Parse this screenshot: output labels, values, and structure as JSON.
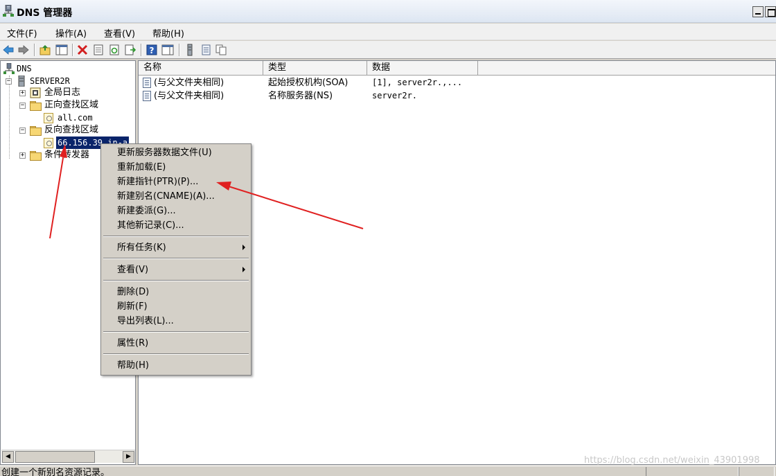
{
  "window": {
    "title": "DNS 管理器",
    "icon": "dns-server-icon"
  },
  "menubar": {
    "items": [
      "文件(F)",
      "操作(A)",
      "查看(V)",
      "帮助(H)"
    ]
  },
  "toolbar": {
    "icons": [
      "back-arrow-icon",
      "forward-arrow-icon",
      "up-folder-icon",
      "show-hide-tree-icon",
      "delete-icon",
      "properties-icon",
      "refresh-icon",
      "export-list-icon",
      "help-icon",
      "console-icon",
      "server-icon",
      "records-icon",
      "copy-icon"
    ]
  },
  "tree": {
    "root": "DNS",
    "server": "SERVER2R",
    "global_log": "全局日志",
    "forward_zones": "正向查找区域",
    "forward_zone_item": "all.com",
    "reverse_zones": "反向查找区域",
    "reverse_zone_item": "66.156.39.in-a",
    "conditional_forwarders": "条件转发器"
  },
  "list": {
    "columns": [
      "名称",
      "类型",
      "数据"
    ],
    "rows": [
      {
        "name": "(与父文件夹相同)",
        "type": "起始授权机构(SOA)",
        "data": "[1], server2r.,..."
      },
      {
        "name": "(与父文件夹相同)",
        "type": "名称服务器(NS)",
        "data": "server2r."
      }
    ]
  },
  "context_menu": {
    "group1": [
      "更新服务器数据文件(U)",
      "重新加载(E)",
      "新建指针(PTR)(P)...",
      "新建别名(CNAME)(A)...",
      "新建委派(G)...",
      "其他新记录(C)..."
    ],
    "all_tasks": "所有任务(K)",
    "view": "查看(V)",
    "group4": [
      "删除(D)",
      "刷新(F)",
      "导出列表(L)..."
    ],
    "properties": "属性(R)",
    "help": "帮助(H)"
  },
  "status": {
    "text": "创建一个新别名资源记录。"
  },
  "watermark": "https://blog.csdn.net/weixin_43901998",
  "colors": {
    "selection": "#0a246a",
    "annotation_arrow": "#e02020",
    "menu_bg": "#d4d0c8"
  }
}
